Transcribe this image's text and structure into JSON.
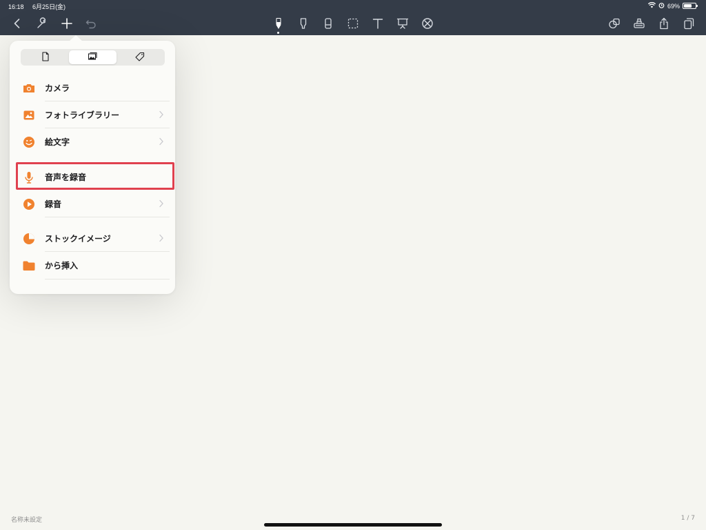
{
  "status_bar": {
    "time": "16:18",
    "date": "6月25日(金)",
    "battery": "69%",
    "battery_level": 0.69
  },
  "toolbar": {
    "left_icons": [
      "chevron-left-icon",
      "wrench-icon",
      "plus-icon",
      "undo-icon"
    ],
    "center_tools": [
      "pen-tool-icon",
      "highlighter-tool-icon",
      "eraser-tool-icon",
      "lasso-select-icon",
      "text-tool-icon",
      "presentation-icon",
      "circle-x-icon"
    ],
    "right_icons": [
      "shapes-icon",
      "stamp-icon",
      "share-icon",
      "pages-icon"
    ],
    "active_tool": "pen-tool-icon"
  },
  "popover": {
    "tabs": [
      {
        "icon": "document-icon",
        "selected": false
      },
      {
        "icon": "image-icon",
        "selected": true
      },
      {
        "icon": "tag-icon",
        "selected": false
      }
    ],
    "items": [
      {
        "label": "カメラ",
        "icon": "camera-icon",
        "chevron": false
      },
      {
        "label": "フォトライブラリー",
        "icon": "photo-library-icon",
        "chevron": true
      },
      {
        "label": "絵文字",
        "icon": "emoji-icon",
        "chevron": true
      },
      {
        "label": "音声を録音",
        "icon": "microphone-icon",
        "chevron": false,
        "highlighted": true
      },
      {
        "label": "録音",
        "icon": "play-circle-icon",
        "chevron": true
      },
      {
        "label": "ストックイメージ",
        "icon": "stock-image-icon",
        "chevron": true
      },
      {
        "label": "から挿入",
        "icon": "folder-icon",
        "chevron": false
      }
    ],
    "accent_color": "#f0822f",
    "highlight_color": "#e0414f"
  },
  "footer": {
    "document_title": "名称未設定",
    "page_indicator": "1 / 7"
  },
  "colors": {
    "toolbar_bg": "#343c48",
    "canvas_bg": "#f5f5f0"
  }
}
